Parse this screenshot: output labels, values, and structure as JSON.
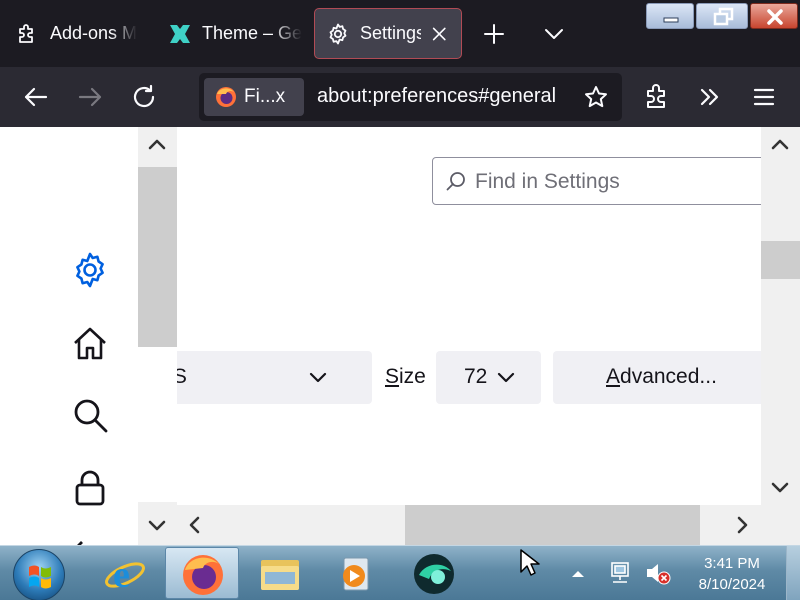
{
  "tabs": [
    {
      "label": "Add-ons M",
      "icon": "puzzle-icon"
    },
    {
      "label": "Theme – Ge",
      "icon": "theme-icon"
    },
    {
      "label": "Settings",
      "icon": "gear-icon",
      "active": true
    }
  ],
  "urlbar": {
    "identity_label": "Fi...x",
    "url": "about:preferences#general"
  },
  "sidebar": {
    "icons": [
      "gear-icon",
      "home-icon",
      "search-icon",
      "lock-icon"
    ]
  },
  "main": {
    "search_placeholder": "Find in Settings",
    "font_value": "IS",
    "size_label_prefix": "S",
    "size_label_rest": "ize",
    "size_value": "72",
    "advanced_prefix": "A",
    "advanced_rest": "dvanced..."
  },
  "taskbar": {
    "apps": [
      "internet-explorer-icon",
      "firefox-icon",
      "file-explorer-icon",
      "media-player-icon",
      "app-icon"
    ],
    "time": "3:41 PM",
    "date": "8/10/2024"
  },
  "colors": {
    "tabstrip": "#1c1b22",
    "navbar": "#2b2a33",
    "active_tab_border": "#b14b55",
    "accent_blue": "#0060df"
  }
}
